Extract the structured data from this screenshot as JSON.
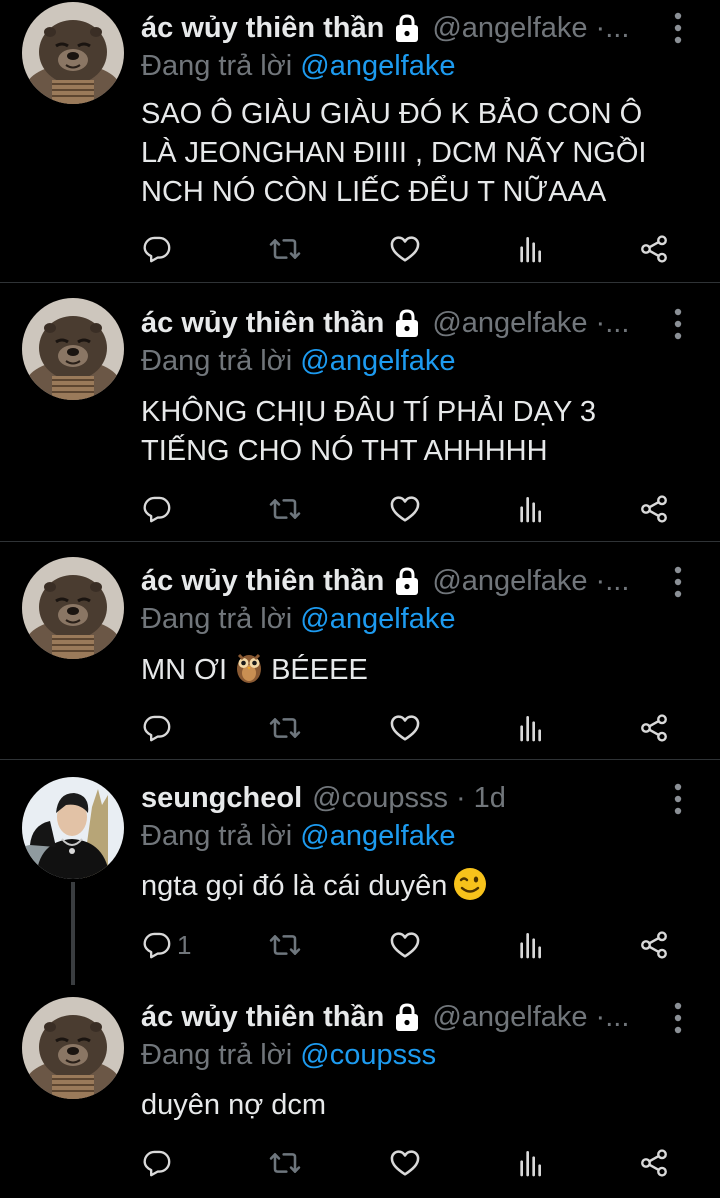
{
  "tweets": [
    {
      "name": "ác wủy thiên thần",
      "handle": "@angelfake",
      "sep": "·...",
      "reply_prefix": "Đang trả lời",
      "reply_to": "@angelfake",
      "text_lines": [
        "SAO Ô GIÀU GIÀU ĐÓ K BẢO CON Ô",
        "LÀ JEONGHAN ĐIIII , DCM NÃY NGỒI",
        "NCH NÓ CÒN LIẾC ĐỂU T NỮAAA"
      ],
      "reply_count": ""
    },
    {
      "name": "ác wủy thiên thần",
      "handle": "@angelfake",
      "sep": "·...",
      "reply_prefix": "Đang trả lời",
      "reply_to": "@angelfake",
      "text_lines": [
        "KHÔNG CHỊU ĐÂU TÍ PHẢI DẠY 3",
        "TIẾNG CHO NÓ THT AHHHHH"
      ],
      "reply_count": ""
    },
    {
      "name": "ác wủy thiên thần",
      "handle": "@angelfake",
      "sep": "·...",
      "reply_prefix": "Đang trả lời",
      "reply_to": "@angelfake",
      "text_before": "MN ƠI",
      "text_after": "BÉEEE",
      "emoji": "owl-emoji",
      "reply_count": ""
    },
    {
      "name": "seungcheol",
      "handle": "@coupsss",
      "sep": "·",
      "time": "1d",
      "reply_prefix": "Đang trả lời",
      "reply_to": "@angelfake",
      "text": "ngta gọi đó là cái duyên",
      "emoji": "winking-face-emoji",
      "reply_count": "1"
    },
    {
      "name": "ác wủy thiên thần",
      "handle": "@angelfake",
      "sep": "·...",
      "reply_prefix": "Đang trả lời",
      "reply_to": "@coupsss",
      "text": "duyên nợ dcm",
      "reply_count": ""
    }
  ],
  "icons": {
    "reply": "reply-icon",
    "retweet": "retweet-icon",
    "like": "heart-icon",
    "views": "views-icon",
    "share": "share-icon",
    "more": "more-vertical-icon",
    "lock": "lock-icon"
  },
  "colors": {
    "background": "#000000",
    "text": "#e7e9ea",
    "muted": "#71767b",
    "link": "#1d9bf0",
    "divider": "#2f3336"
  }
}
